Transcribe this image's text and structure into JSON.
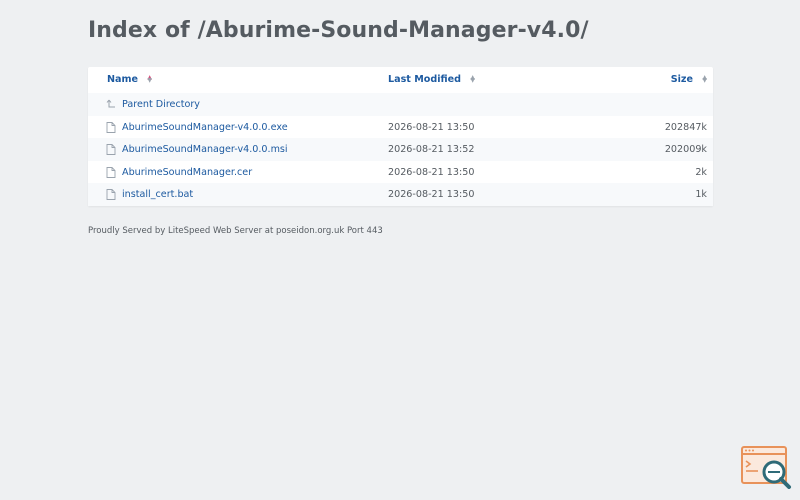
{
  "page": {
    "title": "Index of /Aburime-Sound-Manager-v4.0/"
  },
  "table": {
    "headers": {
      "name": "Name",
      "modified": "Last Modified",
      "size": "Size"
    },
    "parent": {
      "label": "Parent Directory",
      "icon": "parent-arrow-icon"
    },
    "rows": [
      {
        "name": "AburimeSoundManager-v4.0.0.exe",
        "modified": "2026-08-21 13:50",
        "size": "202847k",
        "icon": "file-icon"
      },
      {
        "name": "AburimeSoundManager-v4.0.0.msi",
        "modified": "2026-08-21 13:52",
        "size": "202009k",
        "icon": "file-icon"
      },
      {
        "name": "AburimeSoundManager.cer",
        "modified": "2026-08-21 13:50",
        "size": "2k",
        "icon": "file-icon"
      },
      {
        "name": "install_cert.bat",
        "modified": "2026-08-21 13:50",
        "size": "1k",
        "icon": "file-icon"
      }
    ]
  },
  "footer": {
    "text": "Proudly Served by LiteSpeed Web Server at poseidon.org.uk Port 443"
  },
  "colors": {
    "background": "#eef0f2",
    "link": "#1d5aa0",
    "text": "#555b61",
    "sort_active": "#d2527f",
    "badge_orange": "#e8925a",
    "badge_teal": "#2f6b78"
  }
}
